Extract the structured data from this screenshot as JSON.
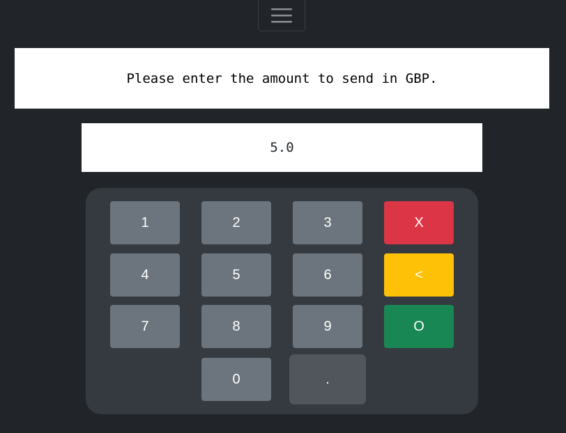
{
  "header": {
    "menu_icon": "hamburger-menu-icon"
  },
  "prompt": {
    "text": "Please enter the amount to send in GBP."
  },
  "amount": {
    "value": "5.0"
  },
  "keypad": {
    "key_1": "1",
    "key_2": "2",
    "key_3": "3",
    "key_4": "4",
    "key_5": "5",
    "key_6": "6",
    "key_7": "7",
    "key_8": "8",
    "key_9": "9",
    "key_0": "0",
    "key_decimal": ".",
    "key_cancel": "X",
    "key_backspace": "<",
    "key_ok": "O"
  },
  "colors": {
    "background": "#212529",
    "keypad_panel": "#343a40",
    "key_default": "#6c757d",
    "key_cancel": "#dc3545",
    "key_backspace": "#ffc107",
    "key_ok": "#198754"
  }
}
